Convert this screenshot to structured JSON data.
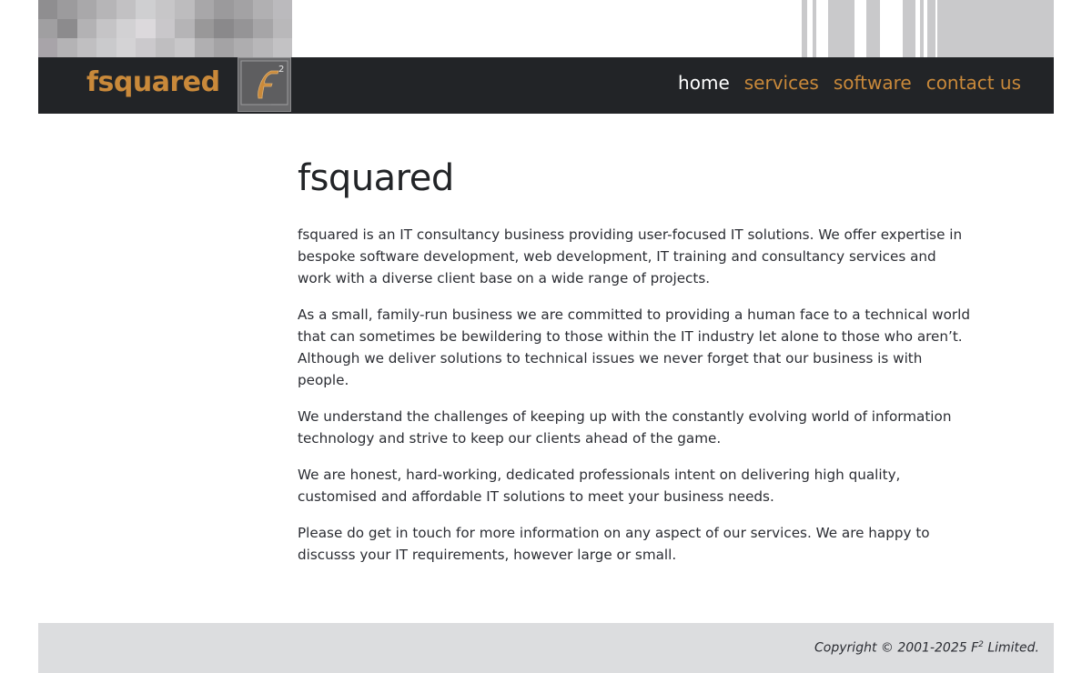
{
  "brand": {
    "name": "fsquared",
    "logo_mark": "F",
    "logo_sup": "2",
    "colors": {
      "brand_orange": "#c9893a",
      "header_bg": "#222427",
      "footer_bg": "#dcdddf"
    }
  },
  "nav": {
    "items": [
      {
        "label": "home",
        "active": true
      },
      {
        "label": "services",
        "active": false
      },
      {
        "label": "software",
        "active": false
      },
      {
        "label": "contact us",
        "active": false
      }
    ]
  },
  "main": {
    "title": "fsquared",
    "paragraphs": [
      "fsquared is an IT consultancy business providing user-focused IT solutions. We offer expertise in bespoke software development, web development, IT training and consultancy services and work with a diverse client base on a wide range of projects.",
      "As a small, family-run business we are committed to providing a human face to a technical world that can sometimes be bewildering to those within the IT industry let alone to those who aren’t. Although we deliver solutions to technical issues we never forget that our business is with people.",
      "We understand the challenges of keeping up with the constantly evolving world of information technology and strive to keep our clients ahead of the game.",
      "We are honest, hard-working, dedicated professionals intent on delivering high quality, customised and affordable IT solutions to meet your business needs.",
      "Please do get in touch for more information on any aspect of our services. We are happy to discusss your IT requirements, however large or small."
    ]
  },
  "footer": {
    "copyright_prefix": "Copyright © 2001-2025 F",
    "copyright_sup": "2",
    "copyright_suffix": " Limited."
  }
}
